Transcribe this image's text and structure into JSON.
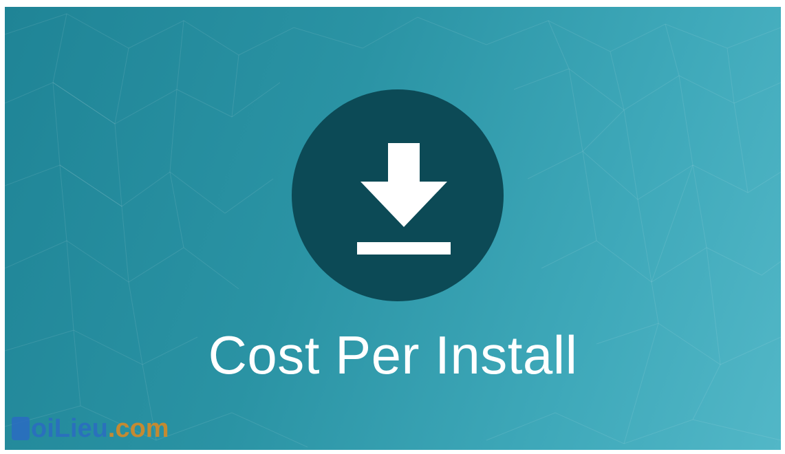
{
  "banner": {
    "headline": "Cost Per Install",
    "icon": "download-icon",
    "colors": {
      "background": "#2a93a4",
      "circle": "#0c4a56",
      "icon": "#ffffff",
      "text": "#ffffff"
    }
  },
  "watermark": {
    "text_part1": "oiLieu",
    "text_part2": ".com"
  }
}
